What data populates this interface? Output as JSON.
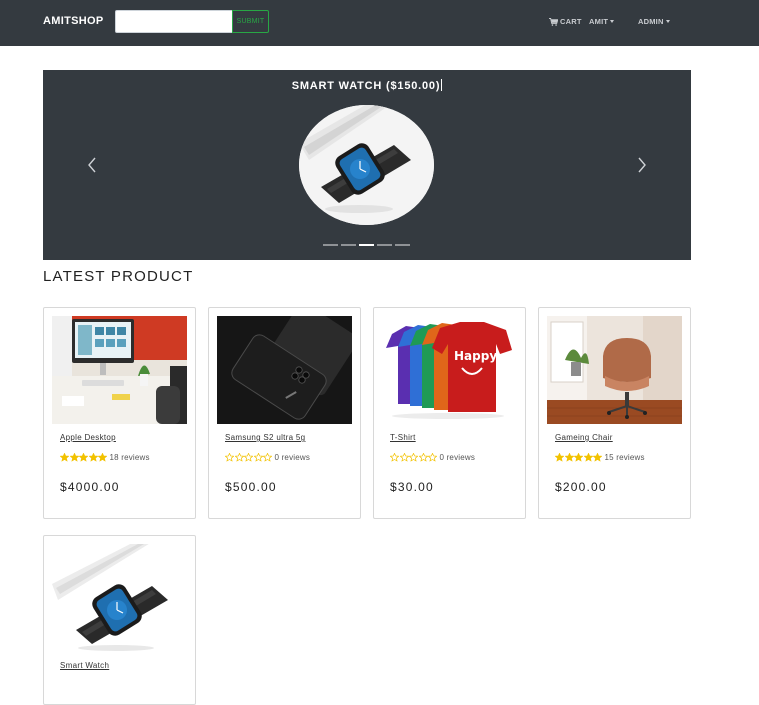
{
  "navbar": {
    "brand": "AMITSHOP",
    "search_placeholder": "",
    "search_button": "SUBMIT",
    "cart_label": "CART",
    "user_label": "AMIT",
    "admin_label": "ADMIN"
  },
  "carousel": {
    "caption": "SMART WATCH ($150.00)",
    "slide_count": 5,
    "active_slide": 3
  },
  "section": {
    "title": "LATEST PRODUCT"
  },
  "products": [
    {
      "name": "Apple Desktop",
      "rating": 5,
      "reviews": "18 reviews",
      "price": "$4000.00",
      "image": "desktop"
    },
    {
      "name": "Samsung S2 ultra 5g",
      "rating": 0,
      "reviews": "0 reviews",
      "price": "$500.00",
      "image": "phone"
    },
    {
      "name": "T-Shirt",
      "rating": 0,
      "reviews": "0 reviews",
      "price": "$30.00",
      "image": "tshirt"
    },
    {
      "name": "Gameing Chair",
      "rating": 5,
      "reviews": "15 reviews",
      "price": "$200.00",
      "image": "chair"
    },
    {
      "name": "Smart Watch",
      "rating": 0,
      "reviews": "",
      "price": "",
      "image": "watch"
    }
  ],
  "colors": {
    "navbar_bg": "#343a40",
    "accent_green": "#28a745",
    "star": "#f2c200"
  }
}
